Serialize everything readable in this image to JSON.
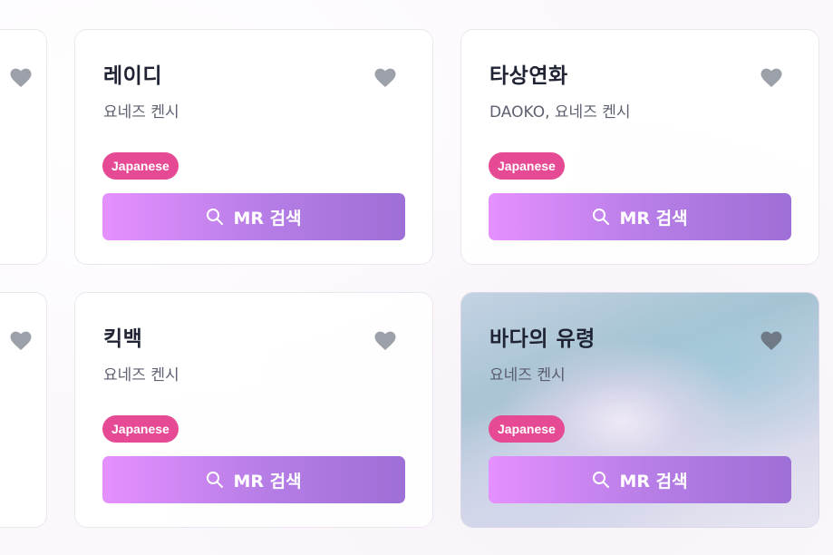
{
  "search_label": "MR 검색",
  "cards": [
    {
      "title": "레이디",
      "artist": "요네즈 켄시",
      "tag": "Japanese"
    },
    {
      "title": "타상연화",
      "artist": "DAOKO, 요네즈 켄시",
      "tag": "Japanese"
    },
    {
      "title": "킥백",
      "artist": "요네즈 켄시",
      "tag": "Japanese"
    },
    {
      "title": "바다의 유령",
      "artist": "요네즈 켄시",
      "tag": "Japanese"
    }
  ],
  "colors": {
    "tag": "#e64a95",
    "button_start": "#e590ff",
    "button_end": "#9e6fd6",
    "heart": "#9ca0a8"
  },
  "icons": {
    "favorite": "heart-icon",
    "search": "search-icon"
  }
}
